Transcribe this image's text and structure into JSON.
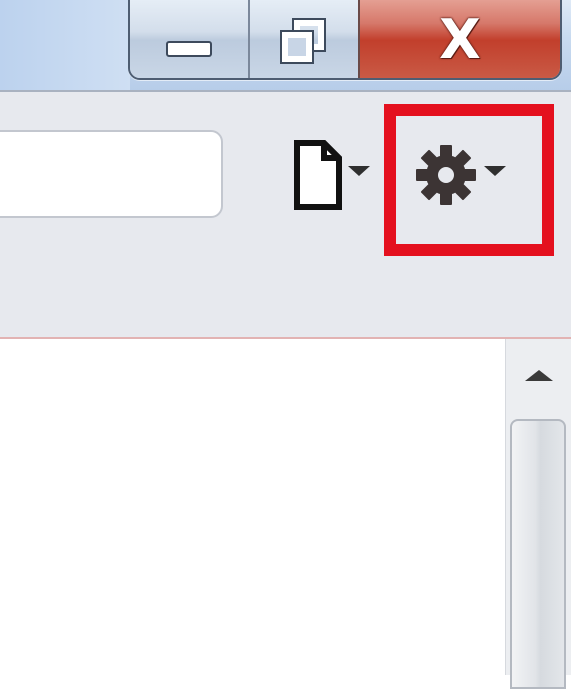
{
  "window": {
    "controls": {
      "minimize": {
        "icon": "minimize-icon"
      },
      "restore": {
        "icon": "restore-down-icon"
      },
      "close": {
        "icon": "close-icon",
        "glyph": "X"
      }
    }
  },
  "toolbar": {
    "search": {
      "value": "",
      "placeholder": ""
    },
    "page_button": {
      "icon": "page-icon",
      "has_dropdown": true
    },
    "settings_button": {
      "icon": "gear-icon",
      "has_dropdown": true,
      "highlighted": true
    }
  },
  "scrollbar": {
    "position": 0.0
  },
  "colors": {
    "highlight": "#e4101e",
    "close_button": "#c23f2c",
    "toolbar_bg": "#e7e9ee",
    "titlebar_bg": "#c9dbf0"
  }
}
